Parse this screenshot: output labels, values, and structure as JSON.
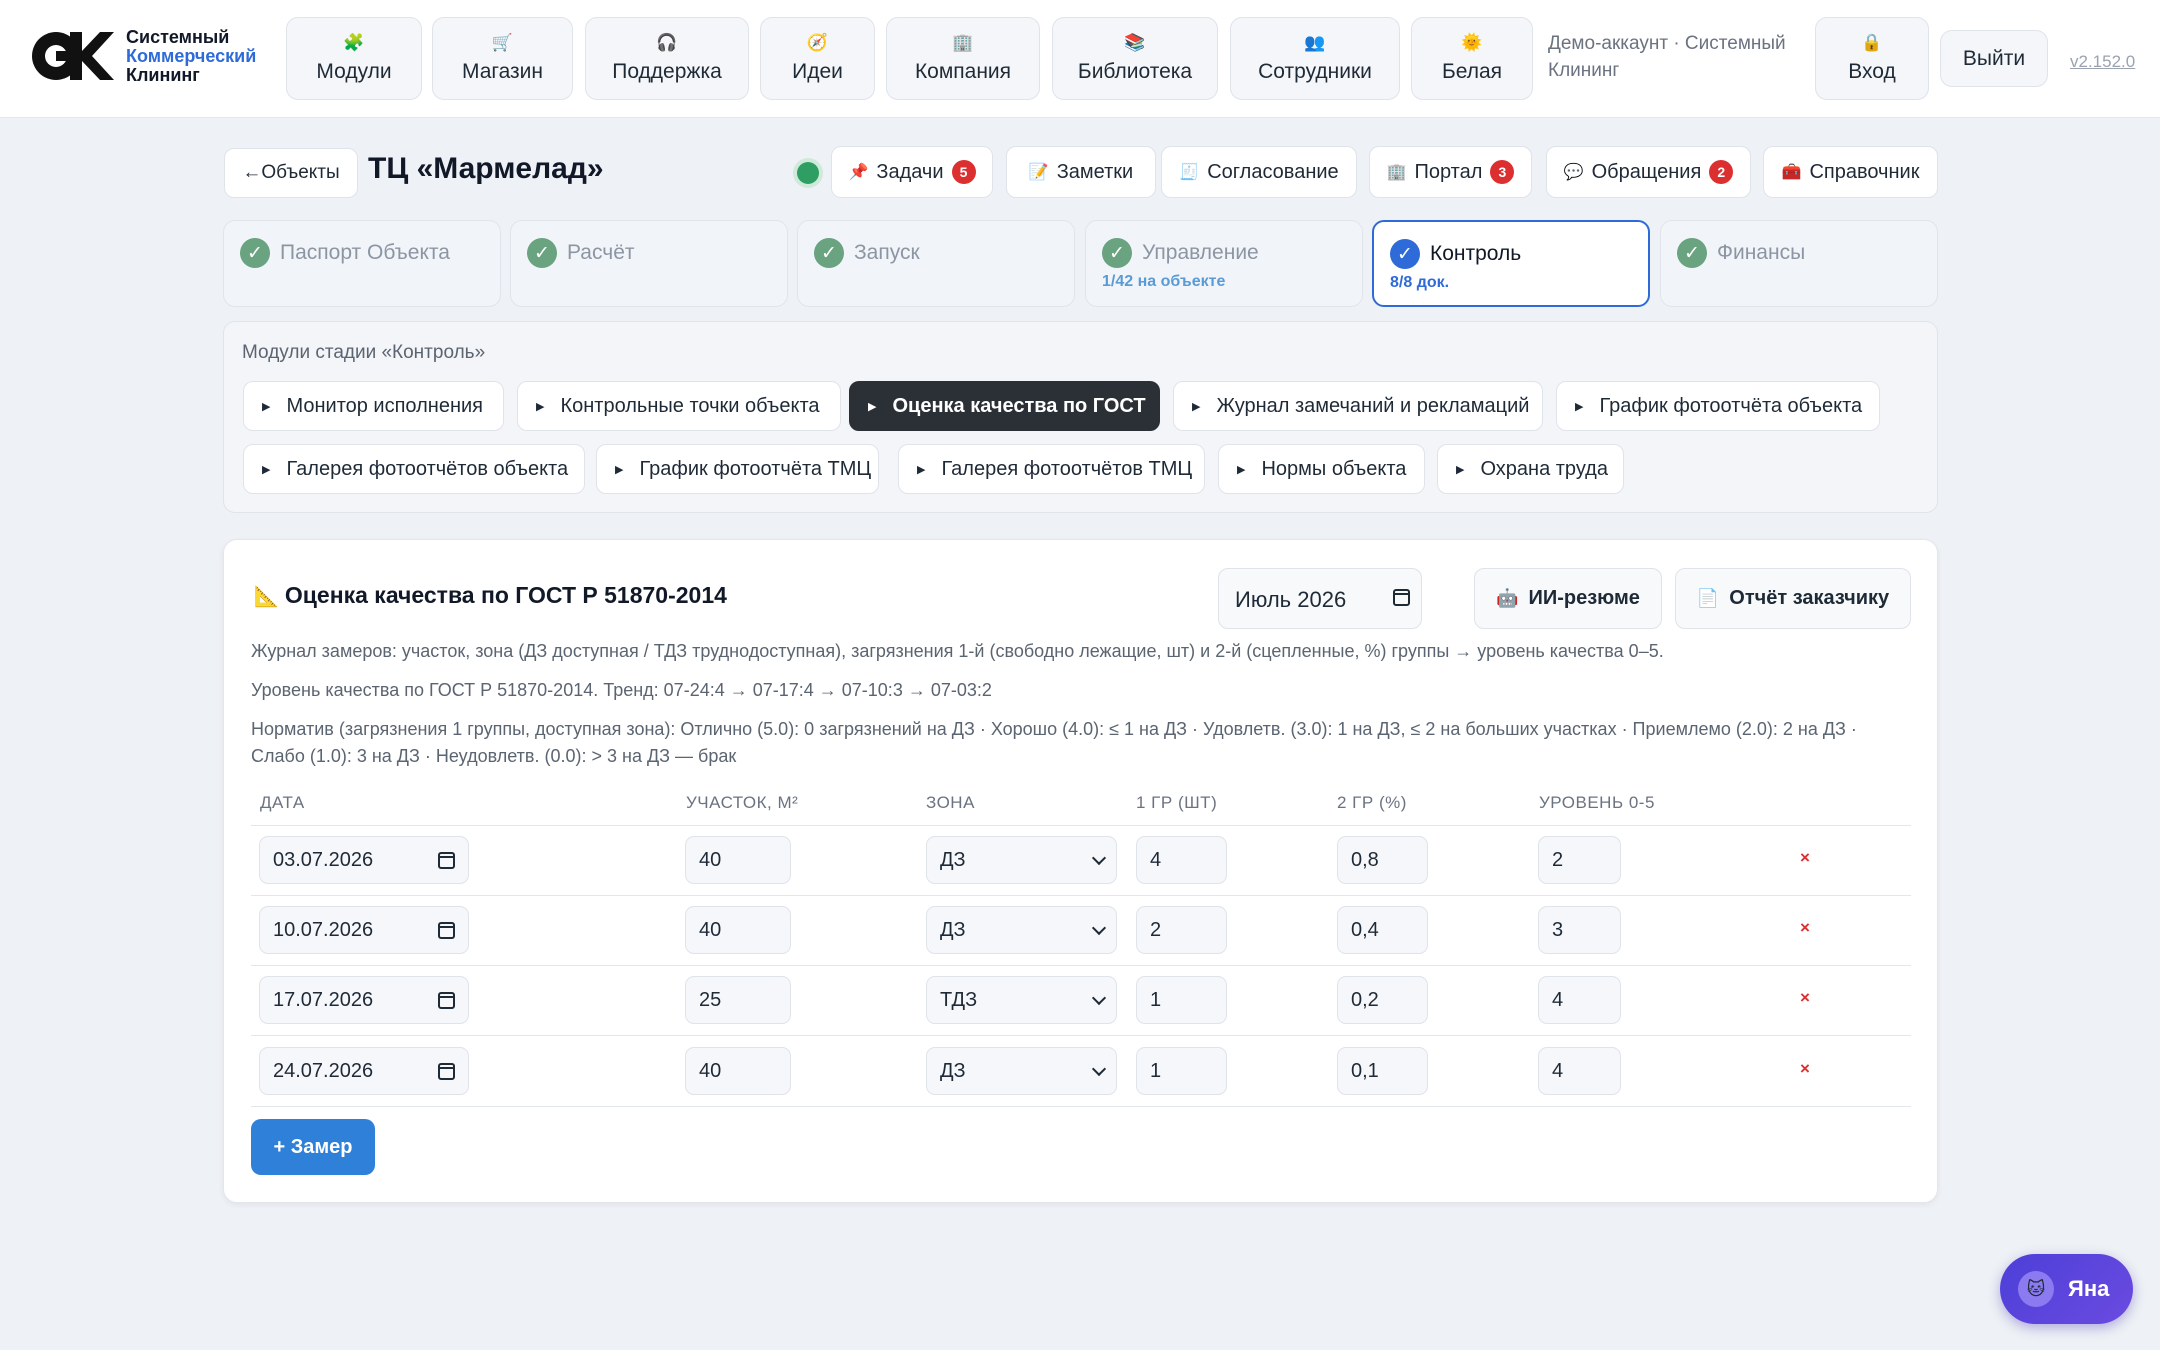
{
  "brand": {
    "line1": "Системный",
    "line2": "Коммерческий",
    "line3": "Клининг"
  },
  "nav": [
    {
      "icon": "🧩",
      "label": "Модули"
    },
    {
      "icon": "🛒",
      "label": "Магазин"
    },
    {
      "icon": "🎧",
      "label": "Поддержка"
    },
    {
      "icon": "🧭",
      "label": "Идеи"
    },
    {
      "icon": "🏢",
      "label": "Компания"
    },
    {
      "icon": "📚",
      "label": "Библиотека"
    },
    {
      "icon": "👥",
      "label": "Сотрудники"
    },
    {
      "icon": "🌞",
      "label": "Белая"
    }
  ],
  "account": {
    "text": "Демо-аккаунт · Системный Клининг",
    "login_icon": "🔒",
    "login_label": "Вход",
    "logout_label": "Выйти",
    "version": "v2.152.0"
  },
  "object": {
    "back_label": "←Объекты",
    "title": "ТЦ «Мармелад»",
    "actions": [
      {
        "icon": "📌",
        "label": "Задачи",
        "badge": "5"
      },
      {
        "icon": "📝",
        "label": "Заметки",
        "badge": ""
      },
      {
        "icon": "🧾",
        "label": "Согласование",
        "badge": ""
      },
      {
        "icon": "🏢",
        "label": "Портал",
        "badge": "3"
      },
      {
        "icon": "💬",
        "label": "Обращения",
        "badge": "2"
      },
      {
        "icon": "🧰",
        "label": "Справочник",
        "badge": ""
      }
    ]
  },
  "stages": [
    {
      "label": "Паспорт Объекта",
      "sub": ""
    },
    {
      "label": "Расчёт",
      "sub": ""
    },
    {
      "label": "Запуск",
      "sub": ""
    },
    {
      "label": "Управление",
      "sub": "1/42 на объекте"
    },
    {
      "label": "Контроль",
      "sub": "8/8 док."
    },
    {
      "label": "Финансы",
      "sub": ""
    }
  ],
  "modules": {
    "caption": "Модули стадии «Контроль»",
    "items": [
      "Монитор исполнения",
      "Контрольные точки объекта",
      "Оценка качества по ГОСТ",
      "Журнал замечаний и рекламаций",
      "График фотоотчёта объекта",
      "Галерея фотоотчётов объекта",
      "График фотоотчёта ТМЦ",
      "Галерея фотоотчётов ТМЦ",
      "Нормы объекта",
      "Охрана труда"
    ]
  },
  "card": {
    "icon": "📐",
    "title": "Оценка качества по ГОСТ Р 51870-2014",
    "month": "Июль 2026",
    "ai_icon": "🤖",
    "ai_label": "ИИ-резюме",
    "report_icon": "📄",
    "report_label": "Отчёт заказчику",
    "desc1": "Журнал замеров: участок, зона (ДЗ доступная / ТДЗ труднодоступная), загрязнения 1-й (свободно лежащие, шт) и 2-й (сцепленные, %) группы → уровень качества 0–5.",
    "desc2": "Уровень качества по ГОСТ Р 51870-2014. Тренд: 07-24:4 → 07-17:4 → 07-10:3 → 07-03:2",
    "desc3a": "Норматив (загрязнения 1 группы, доступная зона): Отлично (5.0): 0 загрязнений на ДЗ · Хорошо (4.0): ≤ 1 на ДЗ · Удовлетв. (3.0): 1 на ДЗ, ≤ 2 на больших участках · Приемлемо (2.0): 2 на ДЗ ·",
    "desc3b": "Слабо (1.0): 3 на ДЗ · Неудовлетв. (0.0): > 3 на ДЗ — брак",
    "headers": [
      "ДАТА",
      "УЧАСТОК, М²",
      "ЗОНА",
      "1 ГР (ШТ)",
      "2 ГР (%)",
      "УРОВЕНЬ 0-5"
    ],
    "rows": [
      {
        "date": "03.07.2026",
        "area": "40",
        "zone": "ДЗ",
        "g1": "4",
        "g2": "0,8",
        "level": "2"
      },
      {
        "date": "10.07.2026",
        "area": "40",
        "zone": "ДЗ",
        "g1": "2",
        "g2": "0,4",
        "level": "3"
      },
      {
        "date": "17.07.2026",
        "area": "25",
        "zone": "ТДЗ",
        "g1": "1",
        "g2": "0,2",
        "level": "4"
      },
      {
        "date": "24.07.2026",
        "area": "40",
        "zone": "ДЗ",
        "g1": "1",
        "g2": "0,1",
        "level": "4"
      }
    ],
    "delete_glyph": "×",
    "add_label": "+ Замер"
  },
  "assistant": {
    "icon": "🐱",
    "name": "Яна"
  },
  "colors": {
    "accent": "#2f6bd8",
    "success": "#2f9e62",
    "danger": "#dc2f2f",
    "active_module": "#2b2f36"
  }
}
